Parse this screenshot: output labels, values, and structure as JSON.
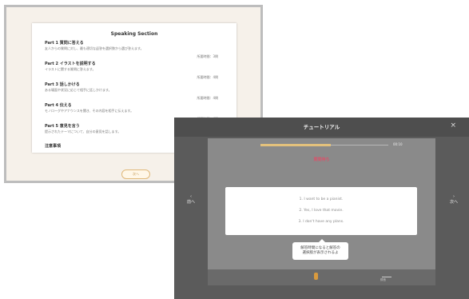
{
  "back_window": {
    "title": "Speaking Section",
    "parts": [
      {
        "title": "Part 1 質問に答える",
        "desc": "友人からの質問に対し、最も適切な返答を選択肢から選び答えます。",
        "time": "所要時間：3問"
      },
      {
        "title": "Part 2 イラストを説明する",
        "desc": "イラストに関する質問に答えます。",
        "time": "所要時間：4問"
      },
      {
        "title": "Part 3 話しかける",
        "desc": "ある場面や状況に応じて相手に話しかけます。",
        "time": "所要時間：4問"
      },
      {
        "title": "Part 4 伝える",
        "desc": "モノローグやアナウンスを聞き、その内容を相手に伝えます。",
        "time": "所要時間：4問"
      },
      {
        "title": "Part 5 意見を言う",
        "desc": "提示されたテーマについて、自分の意見を話します。",
        "time": "所要時間：1問"
      }
    ],
    "notes_title": "注意事項",
    "button_label": "次へ"
  },
  "tutorial": {
    "title": "チュートリアル",
    "close_icon": "close-icon",
    "progress_text": "00:10",
    "progress_fraction": 0.55,
    "question_label": "質問待ち",
    "options": [
      "1. I want to be a pianist.",
      "2. Yes, I love that movie.",
      "3. I don't have any plans."
    ],
    "tooltip_line1": "解答時間になると解答の",
    "tooltip_line2": "選択肢が表示されるよ",
    "prev_label": "前へ",
    "next_label": "次へ",
    "footer_right_label": "録音"
  }
}
